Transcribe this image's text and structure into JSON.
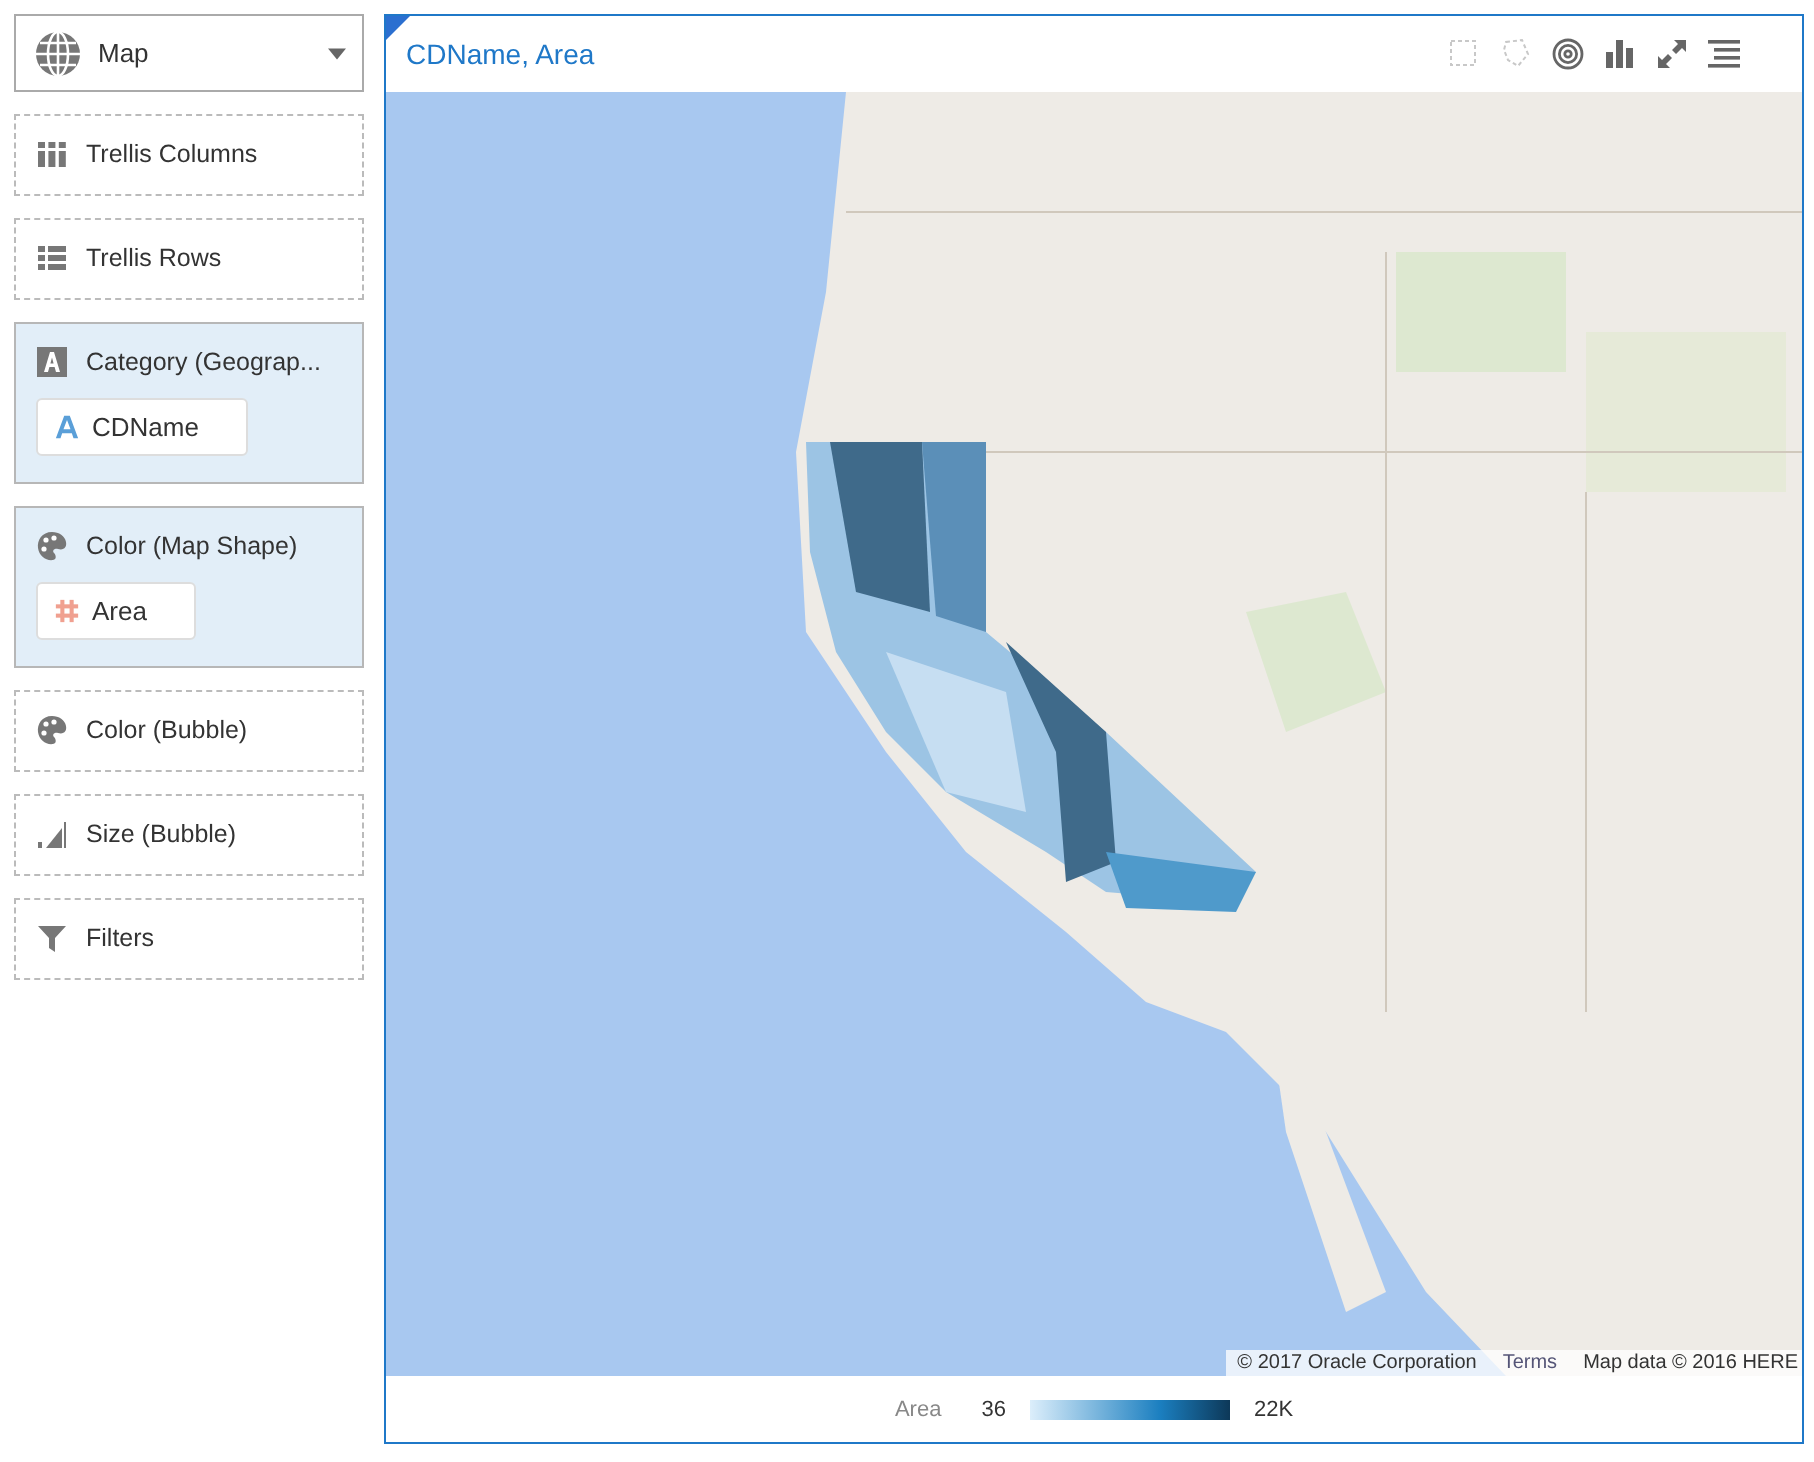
{
  "visualization_picker": {
    "label": "Map"
  },
  "drop_zones": [
    {
      "kind": "columns",
      "label": "Trellis Columns"
    },
    {
      "kind": "rows",
      "label": "Trellis Rows"
    },
    {
      "kind": "category",
      "label": "Category (Geograp...",
      "chips": [
        {
          "kind": "text",
          "label": "CDName"
        }
      ]
    },
    {
      "kind": "color",
      "label": "Color (Map Shape)",
      "chips": [
        {
          "kind": "number",
          "label": "Area"
        }
      ]
    },
    {
      "kind": "color",
      "label": "Color (Bubble)"
    },
    {
      "kind": "size",
      "label": "Size (Bubble)"
    },
    {
      "kind": "filter",
      "label": "Filters"
    }
  ],
  "chart": {
    "title": "CDName, Area",
    "tools": [
      {
        "kind": "rect-select",
        "disabled": true
      },
      {
        "kind": "lasso",
        "disabled": true
      },
      {
        "kind": "target",
        "disabled": false
      },
      {
        "kind": "bars",
        "disabled": false
      },
      {
        "kind": "expand",
        "disabled": false
      },
      {
        "kind": "menu",
        "disabled": false
      }
    ],
    "attribution": [
      "© 2017 Oracle Corporation",
      "Terms",
      "Map data © 2016 HERE"
    ],
    "legend": {
      "title": "Area",
      "min": "36",
      "max": "22K"
    }
  }
}
